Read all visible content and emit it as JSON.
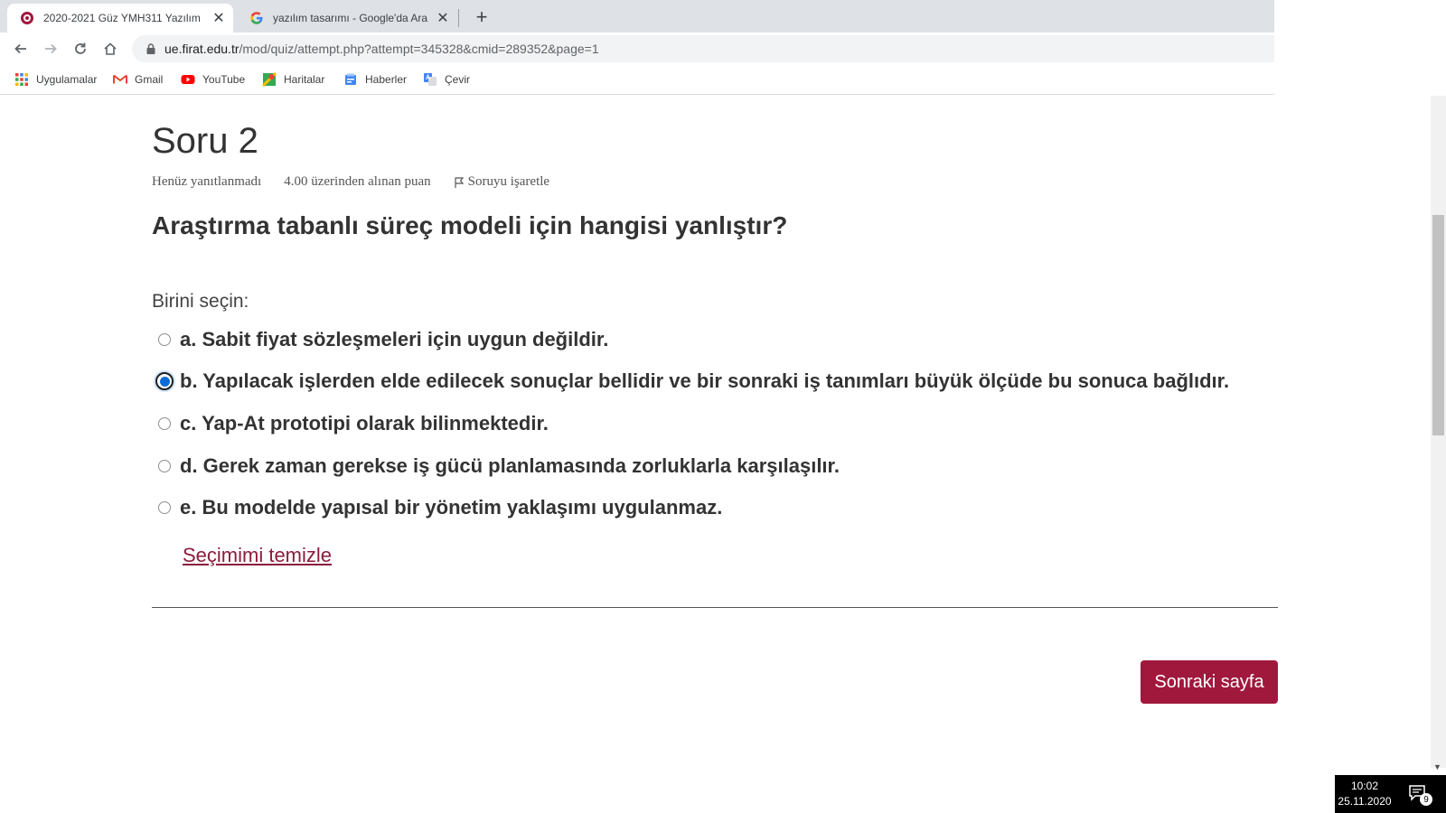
{
  "browser": {
    "tabs": [
      {
        "title": "2020-2021 Güz YMH311 Yazılım",
        "active": true,
        "icon": "fu-logo-icon"
      },
      {
        "title": "yazılım tasarımı - Google'da Ara",
        "active": false,
        "icon": "google-icon"
      }
    ],
    "url_host": "ue.firat.edu.tr",
    "url_path": "/mod/quiz/attempt.php?attempt=345328&cmid=289352&page=1",
    "bookmarks": [
      {
        "label": "Uygulamalar",
        "icon": "apps-icon"
      },
      {
        "label": "Gmail",
        "icon": "gmail-icon"
      },
      {
        "label": "YouTube",
        "icon": "youtube-icon"
      },
      {
        "label": "Haritalar",
        "icon": "maps-icon"
      },
      {
        "label": "Haberler",
        "icon": "news-icon"
      },
      {
        "label": "Çevir",
        "icon": "translate-icon"
      }
    ]
  },
  "question": {
    "title": "Soru 2",
    "state": "Henüz yanıtlanmadı",
    "grade": "4.00 üzerinden alınan puan",
    "flag_label": "Soruyu işaretle",
    "text": "Araştırma tabanlı süreç modeli için hangisi yanlıştır?",
    "prompt": "Birini seçin:",
    "options": [
      {
        "label": "a. Sabit fiyat sözleşmeleri için uygun değildir.",
        "selected": false
      },
      {
        "label": "b. Yapılacak işlerden elde edilecek sonuçlar bellidir ve bir sonraki iş tanımları büyük ölçüde bu sonuca bağlıdır.",
        "selected": true
      },
      {
        "label": "c. Yap-At prototipi olarak bilinmektedir.",
        "selected": false
      },
      {
        "label": "d. Gerek zaman gerekse iş gücü planlamasında zorluklarla karşılaşılır.",
        "selected": false
      },
      {
        "label": "e. Bu modelde yapısal bir yönetim yaklaşımı uygulanmaz.",
        "selected": false
      }
    ],
    "clear_label": "Seçimimi temizle"
  },
  "navigation": {
    "next_label": "Sonraki sayfa"
  },
  "taskbar": {
    "time": "10:02",
    "date": "25.11.2020",
    "notification_count": "9"
  },
  "colors": {
    "accent": "#a1183d",
    "link": "#8b1c3c",
    "radio_selected": "#0b6cd8"
  }
}
